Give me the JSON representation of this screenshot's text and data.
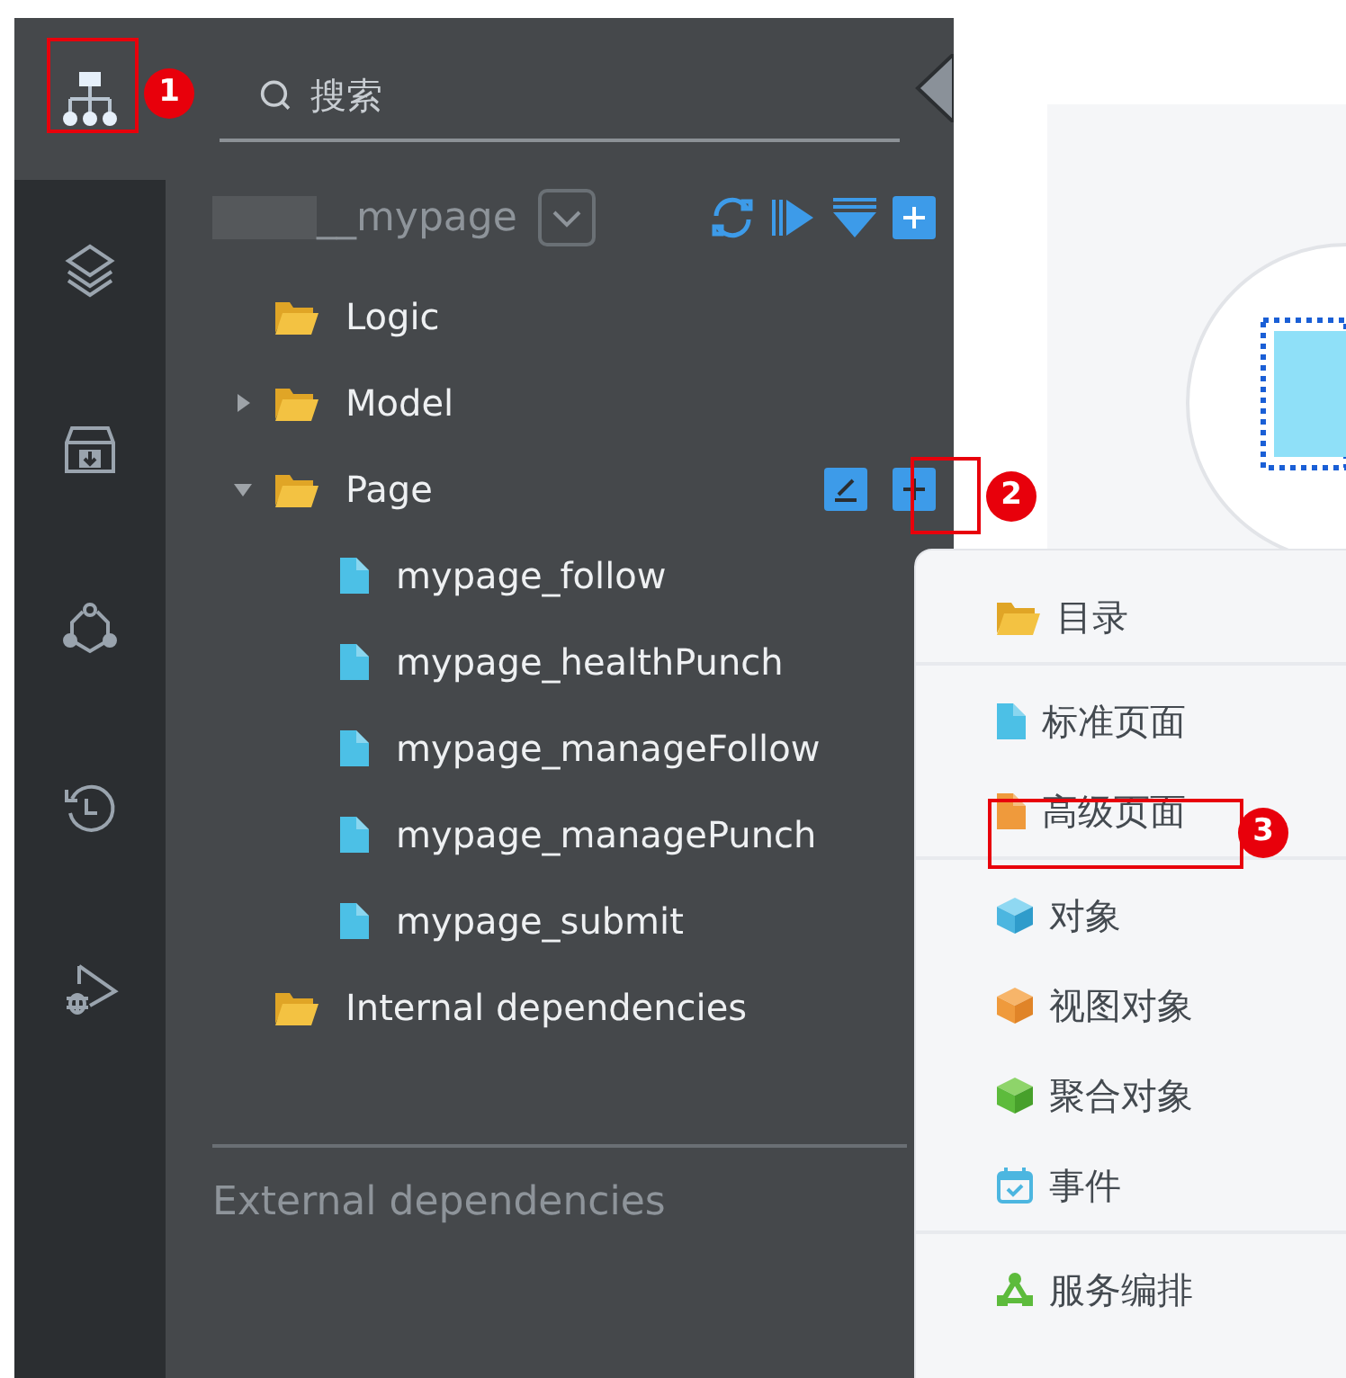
{
  "search": {
    "placeholder": "搜索"
  },
  "project": {
    "name": "__mypage"
  },
  "tree": [
    {
      "label": "Logic",
      "kind": "folder"
    },
    {
      "label": "Model",
      "kind": "folder",
      "expanded": false
    },
    {
      "label": "Page",
      "kind": "folder",
      "expanded": true,
      "children": [
        {
          "label": "mypage_follow",
          "kind": "page"
        },
        {
          "label": "mypage_healthPunch",
          "kind": "page"
        },
        {
          "label": "mypage_manageFollow",
          "kind": "page"
        },
        {
          "label": "mypage_managePunch",
          "kind": "page"
        },
        {
          "label": "mypage_submit",
          "kind": "page"
        }
      ]
    },
    {
      "label": "Internal dependencies",
      "kind": "folder"
    }
  ],
  "external": {
    "label": "External dependencies"
  },
  "menu": {
    "groups": [
      [
        {
          "label": "目录",
          "kind": "folder"
        }
      ],
      [
        {
          "label": "标准页面",
          "kind": "page"
        },
        {
          "label": "高级页面",
          "kind": "advanced-page"
        }
      ],
      [
        {
          "label": "对象",
          "kind": "object"
        },
        {
          "label": "视图对象",
          "kind": "view-object"
        },
        {
          "label": "聚合对象",
          "kind": "aggregate-object"
        },
        {
          "label": "事件",
          "kind": "event"
        }
      ],
      [
        {
          "label": "服务编排",
          "kind": "flow"
        }
      ]
    ]
  },
  "annotations": [
    {
      "label": "1"
    },
    {
      "label": "2"
    },
    {
      "label": "3"
    }
  ]
}
